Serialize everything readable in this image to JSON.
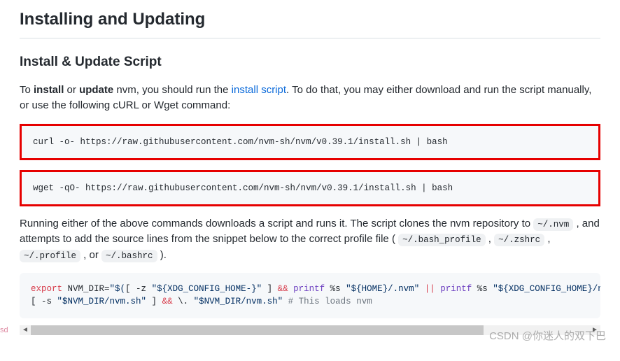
{
  "heading": "Installing and Updating",
  "subheading": "Install & Update Script",
  "intro": {
    "pre": "To ",
    "b1": "install",
    "mid1": " or ",
    "b2": "update",
    "mid2": " nvm, you should run the ",
    "link": "install script",
    "post": ". To do that, you may either download and run the script manually, or use the following cURL or Wget command:"
  },
  "code1": {
    "cmd": "curl -o- https://raw.githubusercontent.com/nvm-sh/nvm/v0.39.1/install.sh",
    "pipe": " | ",
    "tail": "bash"
  },
  "code2": {
    "cmd": "wget -qO- https://raw.githubusercontent.com/nvm-sh/nvm/v0.39.1/install.sh",
    "pipe": " | ",
    "tail": "bash"
  },
  "para2": {
    "a": "Running either of the above commands downloads a script and runs it. The script clones the nvm repository to ",
    "c1": "~/.nvm",
    "b": " , and attempts to add the source lines from the snippet below to the correct profile file ( ",
    "c2": "~/.bash_profile",
    "m1": " , ",
    "c3": "~/.zshrc",
    "m2": " , ",
    "c4": "~/.profile",
    "m3": " , or ",
    "c5": "~/.bashrc",
    "end": " )."
  },
  "code3": {
    "l1_kw1": "export",
    "l1_var": " NVM_DIR=",
    "l1_s1": "\"$(",
    "l1_t1": "[ -z ",
    "l1_s2": "\"${XDG_CONFIG_HOME-}\"",
    "l1_t2": " ] ",
    "l1_op1": "&&",
    "l1_t3": " ",
    "l1_cmd1": "printf",
    "l1_t4": " %s ",
    "l1_s3": "\"${HOME}/.nvm\"",
    "l1_t5": " ",
    "l1_op2": "||",
    "l1_t6": " ",
    "l1_cmd2": "printf",
    "l1_t7": " %s ",
    "l1_s4": "\"${XDG_CONFIG_HOME}/n",
    "l2_t1": "[ -s ",
    "l2_s1": "\"$NVM_DIR/nvm.sh\"",
    "l2_t2": " ] ",
    "l2_op1": "&&",
    "l2_t3": " ",
    "l2_bs": "\\.",
    "l2_t4": " ",
    "l2_s2": "\"$NVM_DIR/nvm.sh\"",
    "l2_t5": " ",
    "l2_cmt": "# This loads nvm"
  },
  "watermark": "CSDN @你迷人的双下巴",
  "sidemark": "sd"
}
